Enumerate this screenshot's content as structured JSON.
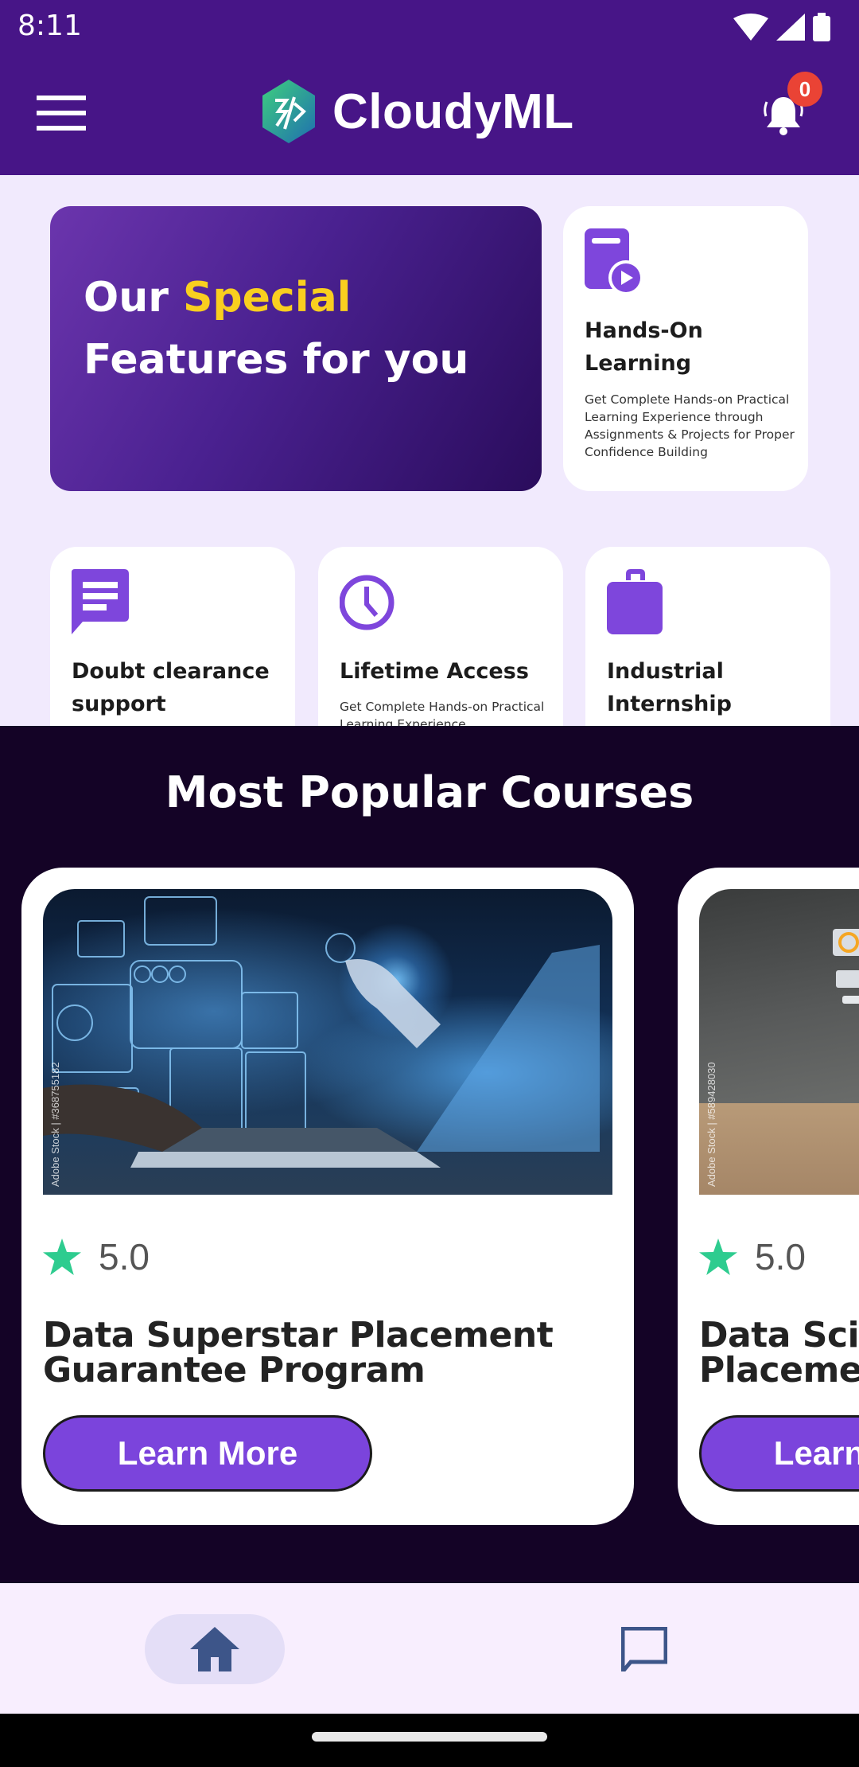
{
  "status_bar": {
    "time": "8:11",
    "icons": [
      "wifi-icon",
      "cellular-signal-icon",
      "battery-icon"
    ]
  },
  "app_bar": {
    "menu_icon": "hamburger-menu-icon",
    "logo_icon": "cloudyml-logo-icon",
    "title": "CloudyML",
    "notification_icon": "bell-icon",
    "notification_count": "0"
  },
  "colors": {
    "app_bar": "#471587",
    "accent_purple": "#7b44dc",
    "highlight_yellow": "#f9cf1f",
    "rating_star": "#2ecc8f",
    "courses_bg": "#140326",
    "badge_red": "#ea4335"
  },
  "hero": {
    "line1_prefix": "Our ",
    "line1_highlight": "Special",
    "line2": "Features for you"
  },
  "features": [
    {
      "icon": "book-play-icon",
      "title": "Hands-On Learning",
      "description": "Get Complete Hands-on Practical Learning Experience through Assignments & Projects for Proper Confidence Building"
    },
    {
      "icon": "chat-message-icon",
      "title": "Doubt clearance support",
      "description": ""
    },
    {
      "icon": "clock-icon",
      "title": "Lifetime Access",
      "description": "Get Complete Hands-on Practical Learning Experience"
    },
    {
      "icon": "briefcase-icon",
      "title": "Industrial Internship",
      "description": ""
    }
  ],
  "courses_section": {
    "title": "Most Popular Courses",
    "courses": [
      {
        "image_alt": "Robot hand touching laptop with data dashboards",
        "watermark": "Adobe Stock | #368755182",
        "rating": "5.0",
        "title_line1": "Data Superstar Placement",
        "title_line2": "Guarantee Program",
        "button_label": "Learn More"
      },
      {
        "image_alt": "Laptop with floating analytics widgets",
        "watermark": "Adobe Stock | #589428030",
        "rating": "5.0",
        "title_line1": "Data Science",
        "title_line2": "Placement",
        "button_label": "Learn More"
      }
    ]
  },
  "bottom_nav": {
    "items": [
      {
        "icon": "home-icon",
        "active": true
      },
      {
        "icon": "chat-icon",
        "active": false
      }
    ]
  }
}
